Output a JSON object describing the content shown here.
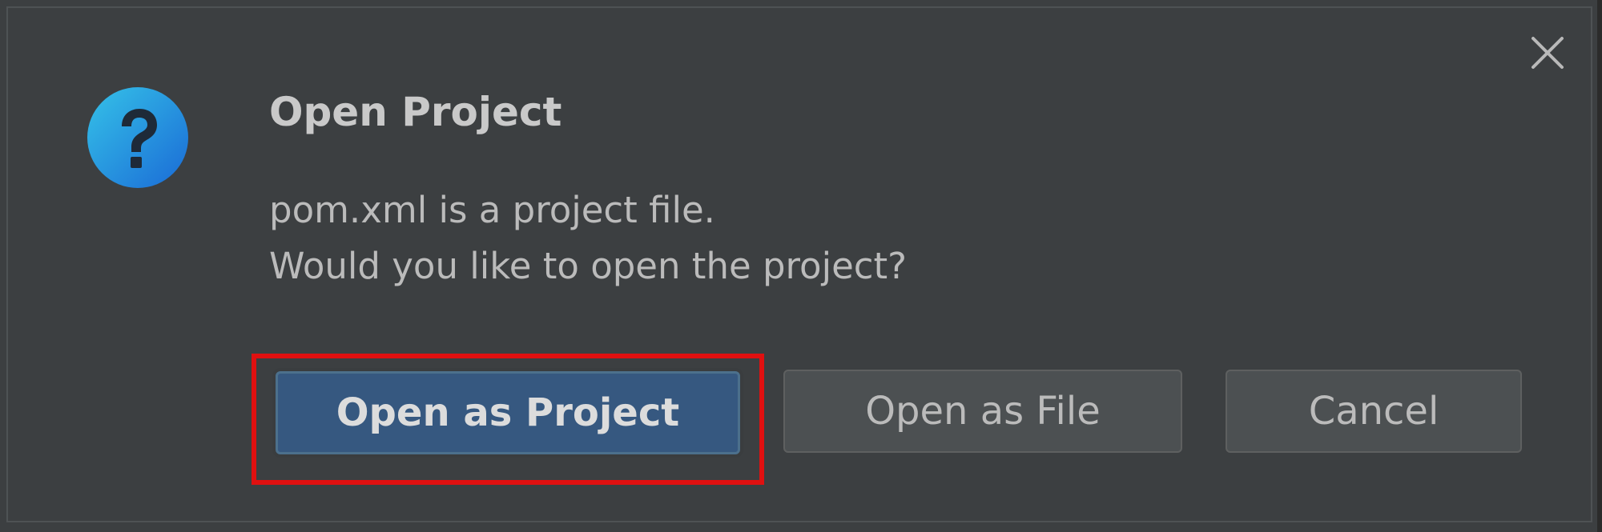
{
  "dialog": {
    "title": "Open Project",
    "message_lines": [
      "pom.xml is a project file.",
      "Would you like to open the project?"
    ],
    "icons": {
      "question": "question-icon",
      "close": "close-icon"
    },
    "buttons": {
      "open_as_project": "Open as Project",
      "open_as_file": "Open as File",
      "cancel": "Cancel"
    },
    "highlighted_button": "open_as_project"
  },
  "colors": {
    "background": "#3c3f41",
    "primary_button": "#365880",
    "secondary_button": "#4c5052",
    "text": "#bbbbbb",
    "highlight": "#e01010",
    "icon_gradient_top": "#2fb2e6",
    "icon_gradient_bottom": "#1b6fd8"
  }
}
